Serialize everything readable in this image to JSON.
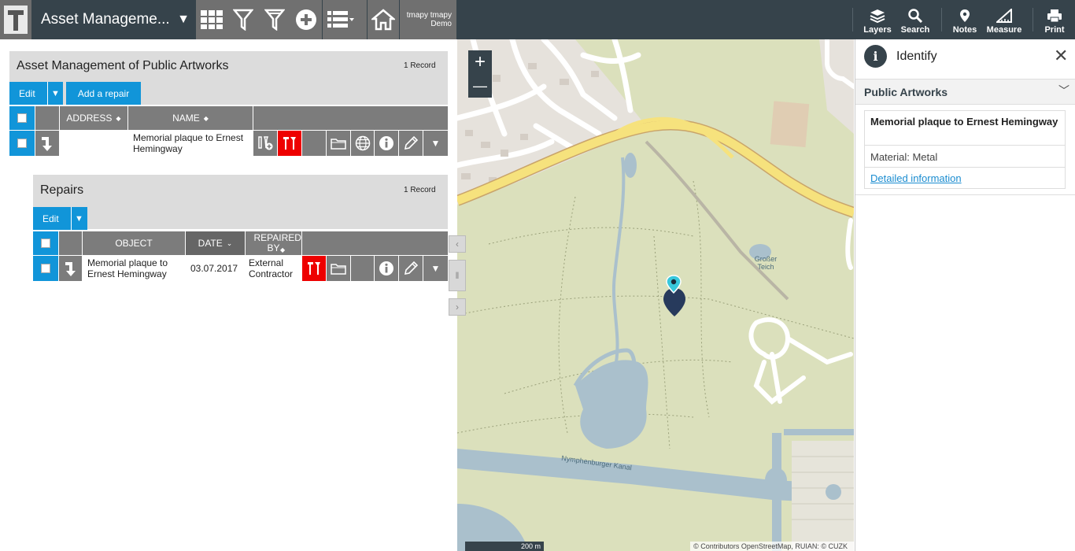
{
  "header": {
    "app_title": "Asset Manageme...",
    "user_name": "tmapy tmapy",
    "user_role": "Demo",
    "tools": [
      {
        "label": "Layers",
        "icon": "layers-icon"
      },
      {
        "label": "Search",
        "icon": "search-icon"
      },
      {
        "label": "Notes",
        "icon": "map-pin-icon"
      },
      {
        "label": "Measure",
        "icon": "ruler-icon"
      },
      {
        "label": "Print",
        "icon": "printer-icon"
      }
    ]
  },
  "artworks_panel": {
    "title": "Asset Management of Public Artworks",
    "record_count": "1 Record",
    "edit_label": "Edit",
    "add_repair_label": "Add a repair",
    "columns": {
      "address": "ADDRESS",
      "name": "NAME"
    },
    "rows": [
      {
        "address": "",
        "name": "Memorial plaque to Ernest Hemingway"
      }
    ]
  },
  "repairs_panel": {
    "title": "Repairs",
    "record_count": "1 Record",
    "edit_label": "Edit",
    "columns": {
      "object": "OBJECT",
      "date": "DATE",
      "repaired_by": "REPAIRED BY"
    },
    "rows": [
      {
        "object": "Memorial plaque to Ernest Hemingway",
        "date": "03.07.2017",
        "repaired_by": "External Contractor"
      }
    ]
  },
  "map": {
    "zoom_in": "+",
    "zoom_out": "—",
    "scale_label": "200 m",
    "attribution": "© Contributors OpenStreetMap, RUIAN: © CUZK",
    "labels": {
      "pond": "Großer Teich",
      "canal": "Nymphenburger Kanal"
    },
    "colors": {
      "land": "#dbe0bc",
      "water": "#aac0cc",
      "road": "#f6e27d",
      "pin": "#273a5c",
      "pin_head": "#38c8dc"
    }
  },
  "identify": {
    "title": "Identify",
    "group": "Public Artworks",
    "feature_title": "Memorial plaque to Ernest Hemingway",
    "material": "Material: Metal",
    "link": "Detailed information"
  }
}
